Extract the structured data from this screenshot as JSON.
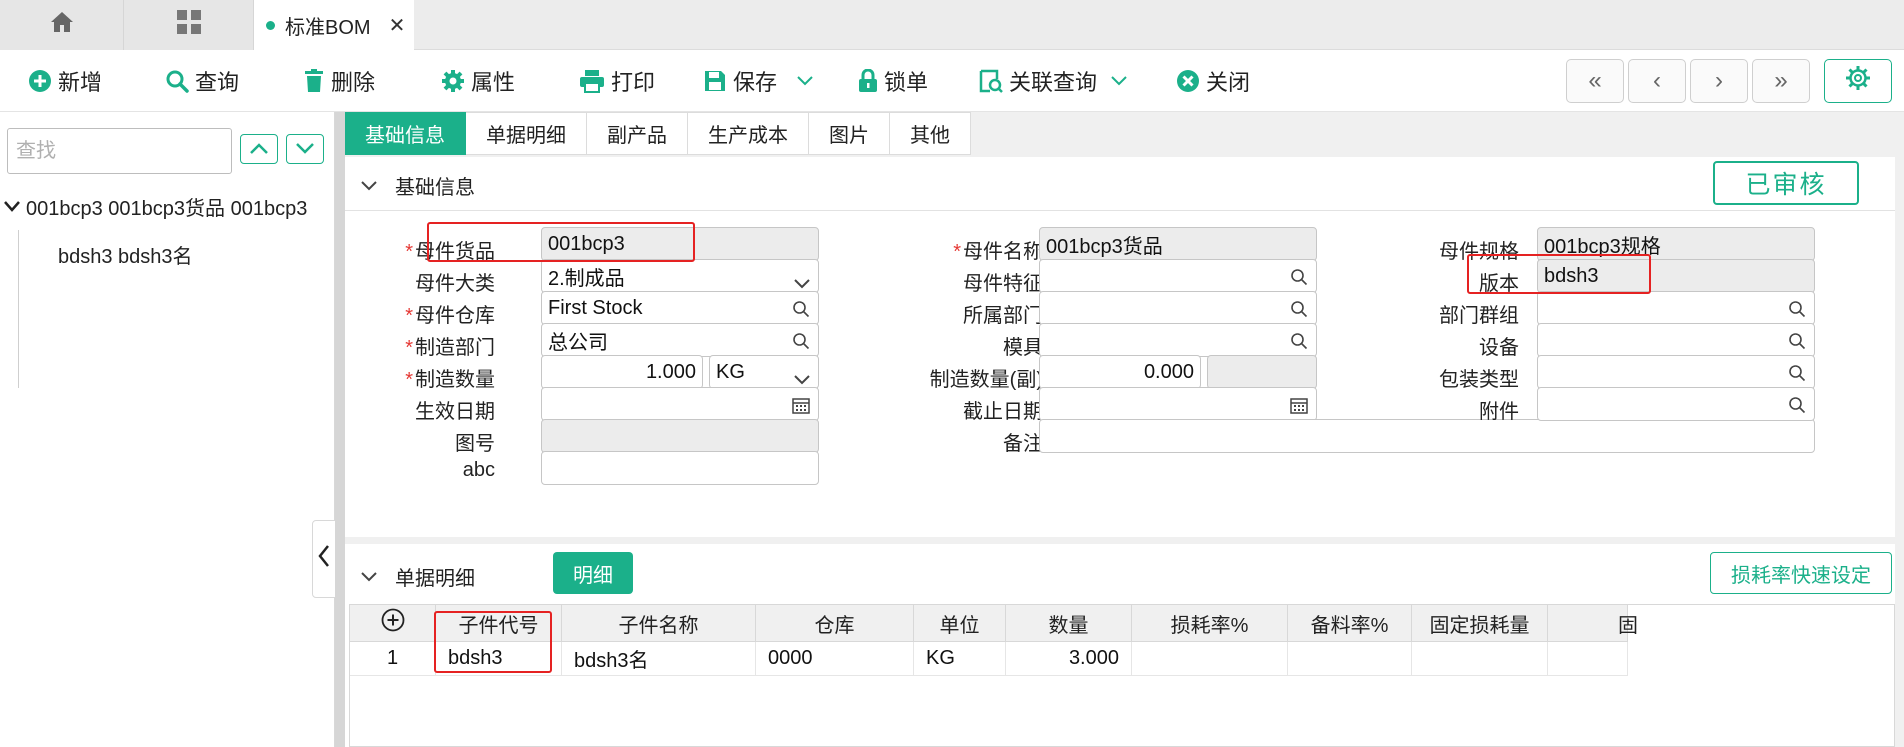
{
  "tabs": {
    "home_icon": "home-icon",
    "apps_icon": "grid-icon",
    "active_label": "标准BOM",
    "close_glyph": "✕"
  },
  "toolbar": {
    "add": "新增",
    "query": "查询",
    "delete": "删除",
    "properties": "属性",
    "print": "打印",
    "save": "保存",
    "lock": "锁单",
    "related_query": "关联查询",
    "close": "关闭",
    "nav_first": "«",
    "nav_prev": "‹",
    "nav_next": "›",
    "nav_last": "»"
  },
  "left": {
    "search_placeholder": "查找",
    "tree_root": "001bcp3 001bcp3货品 001bcp3",
    "tree_child": "bdsh3 bdsh3名"
  },
  "subtabs": [
    "基础信息",
    "单据明细",
    "副产品",
    "生产成本",
    "图片",
    "其他"
  ],
  "basic": {
    "section_title": "基础信息",
    "status": "已审核",
    "labels": {
      "parent_goods": "母件货品",
      "parent_name": "母件名称",
      "parent_spec": "母件规格",
      "parent_category": "母件大类",
      "parent_feature": "母件特征",
      "version": "版本",
      "parent_warehouse": "母件仓库",
      "dept": "所属部门",
      "dept_group": "部门群组",
      "mfg_dept": "制造部门",
      "mold": "模具",
      "equipment": "设备",
      "mfg_qty": "制造数量",
      "mfg_qty_sub": "制造数量(副)",
      "pack_type": "包装类型",
      "effective_date": "生效日期",
      "end_date": "截止日期",
      "attachment": "附件",
      "drawing_no": "图号",
      "remark": "备注",
      "abc": "abc"
    },
    "values": {
      "parent_goods": "001bcp3",
      "parent_name": "001bcp3货品",
      "parent_spec": "001bcp3规格",
      "parent_category": "2.制成品",
      "parent_feature": "",
      "version": "bdsh3",
      "parent_warehouse": "First Stock",
      "dept": "",
      "dept_group": "",
      "mfg_dept": "总公司",
      "mold": "",
      "equipment": "",
      "mfg_qty": "1.000",
      "unit": "KG",
      "mfg_qty_sub": "0.000",
      "pack_type": "",
      "effective_date": "",
      "end_date": "",
      "attachment": "",
      "drawing_no": "",
      "remark": "",
      "abc": ""
    }
  },
  "detail": {
    "section_title": "单据明细",
    "tag": "明细",
    "loss_button": "损耗率快速设定",
    "columns": [
      "子件代号",
      "子件名称",
      "仓库",
      "单位",
      "数量",
      "损耗率%",
      "备料率%",
      "固定损耗量",
      "固"
    ],
    "rows": [
      {
        "no": "1",
        "code": "bdsh3",
        "name": "bdsh3名",
        "warehouse": "0000",
        "unit": "KG",
        "qty": "3.000"
      }
    ]
  },
  "colors": {
    "accent": "#1bb08a",
    "highlight": "#e52222",
    "required": "#e53935"
  }
}
